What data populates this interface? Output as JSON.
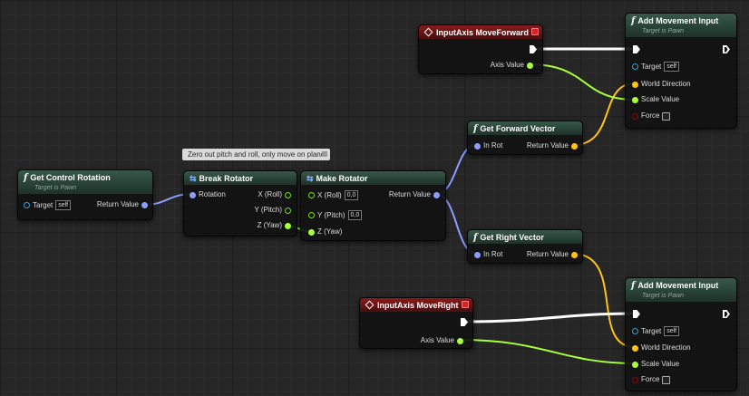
{
  "comment": "Zero out pitch and roll, only move on plane",
  "get_control_rotation": {
    "title": "Get Control Rotation",
    "subtitle": "Target is Pawn",
    "target_label": "Target",
    "target_value": "self",
    "return_label": "Return Value"
  },
  "break_rotator": {
    "title": "Break Rotator",
    "in_label": "Rotation",
    "x_label": "X (Roll)",
    "y_label": "Y (Pitch)",
    "z_label": "Z (Yaw)"
  },
  "make_rotator": {
    "title": "Make Rotator",
    "x_label": "X (Roll)",
    "x_value": "0,0",
    "y_label": "Y (Pitch)",
    "y_value": "0,0",
    "z_label": "Z (Yaw)",
    "return_label": "Return Value"
  },
  "input_forward": {
    "title": "InputAxis MoveForward",
    "axis_label": "Axis Value"
  },
  "input_right": {
    "title": "InputAxis MoveRight",
    "axis_label": "Axis Value"
  },
  "get_forward_vector": {
    "title": "Get Forward Vector",
    "in_label": "In Rot",
    "return_label": "Return Value"
  },
  "get_right_vector": {
    "title": "Get Right Vector",
    "in_label": "In Rot",
    "return_label": "Return Value"
  },
  "add_movement_1": {
    "title": "Add Movement Input",
    "subtitle": "Target is Pawn",
    "target_label": "Target",
    "target_value": "self",
    "world_direction_label": "World Direction",
    "scale_value_label": "Scale Value",
    "force_label": "Force"
  },
  "add_movement_2": {
    "title": "Add Movement Input",
    "subtitle": "Target is Pawn",
    "target_label": "Target",
    "target_value": "self",
    "world_direction_label": "World Direction",
    "scale_value_label": "Scale Value",
    "force_label": "Force"
  },
  "icons": {
    "function": "function-icon",
    "event": "event-diamond-icon",
    "convert": "conversion-icon",
    "exec": "exec-arrow-icon"
  },
  "colors": {
    "function_header": "#38584a",
    "event_header": "#8a1c1c",
    "rotator_pin": "#8c9cff",
    "float_pin": "#a6ff3a",
    "vector_pin": "#ffc31a",
    "object_pin": "#2fa6d8",
    "exec_wire": "#ffffff"
  }
}
